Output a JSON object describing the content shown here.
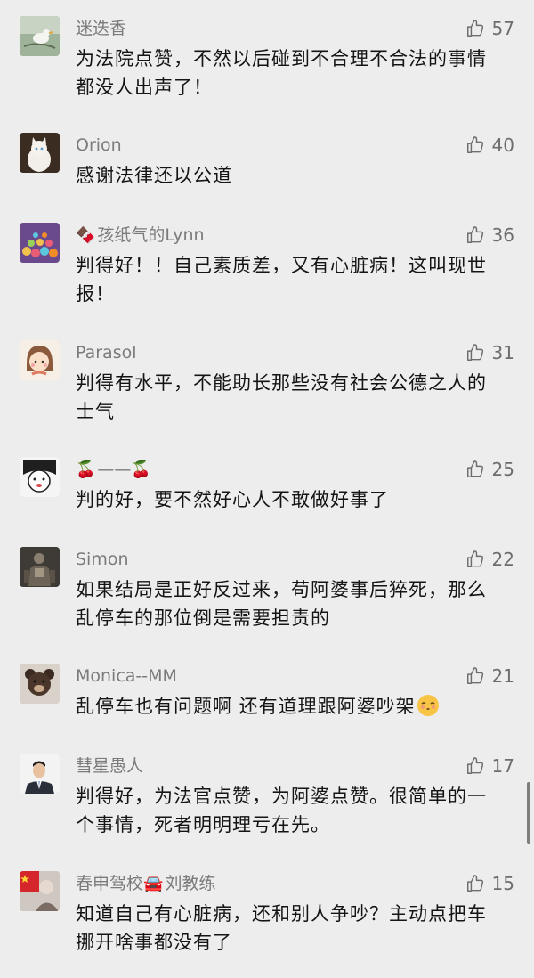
{
  "comments": [
    {
      "name": "迷迭香",
      "likes": "57",
      "text": "为法院点赞，不然以后碰到不合理不合法的事情都没人出声了！",
      "avatar_icon": "bird-on-branch-avatar"
    },
    {
      "name": "Orion",
      "likes": "40",
      "text": "感谢法律还以公道",
      "avatar_icon": "white-cat-avatar"
    },
    {
      "name": "孩纸气的Lynn",
      "name_prefix_emoji": "🍫",
      "likes": "36",
      "text": "判得好！！自己素质差，又有心脏病！这叫现世报！",
      "avatar_icon": "colorful-balls-avatar"
    },
    {
      "name": "Parasol",
      "likes": "31",
      "text": "判得有水平，不能助长那些没有社会公德之人的士气",
      "avatar_icon": "cartoon-girl-avatar"
    },
    {
      "name": "——",
      "name_prefix_emoji": "🍒",
      "name_suffix_emoji": "🍒",
      "likes": "25",
      "text": "判的好，要不然好心人不敢做好事了",
      "avatar_icon": "cartoon-face-avatar"
    },
    {
      "name": "Simon",
      "likes": "22",
      "text": "如果结局是正好反过来，苟阿婆事后猝死，那么乱停车的那位倒是需要担责的",
      "avatar_icon": "armored-figure-avatar"
    },
    {
      "name": "Monica--MM",
      "likes": "21",
      "text": "乱停车也有问题啊 还有道理跟阿婆吵架",
      "text_suffix_emoji": "kissing-face-emoji",
      "avatar_icon": "plush-bear-avatar"
    },
    {
      "name": "彗星愚人",
      "likes": "17",
      "text": "判得好，为法官点赞，为阿婆点赞。很简单的一个事情，死者明明理亏在先。",
      "avatar_icon": "man-in-suit-avatar"
    },
    {
      "name": "刘教练",
      "name_prefix": "春申驾校",
      "name_mid_emoji": "🚘",
      "likes": "15",
      "text": "知道自己有心脏病，还和别人争吵？主动点把车挪开啥事都没有了",
      "avatar_icon": "flag-and-figure-avatar"
    }
  ],
  "colors": {
    "background": "#ededed",
    "nickname": "#7b7b7b",
    "content": "#141414",
    "like": "#6d6d6d"
  },
  "icons": {
    "like": "thumbs-up-outline-icon"
  }
}
